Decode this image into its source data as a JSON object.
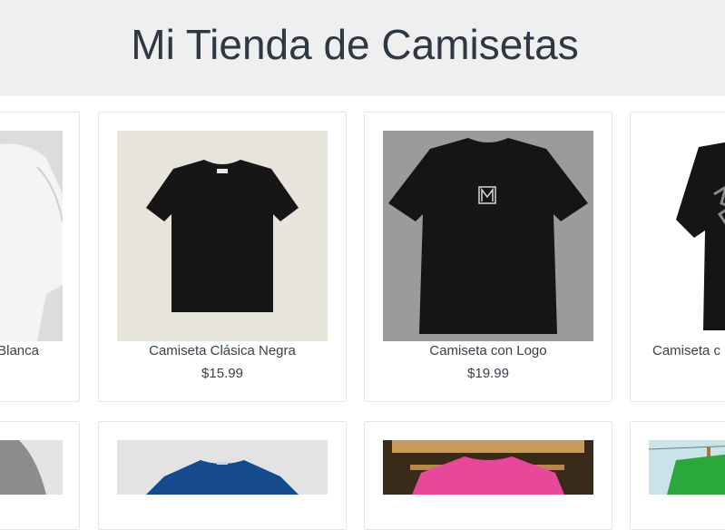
{
  "header": {
    "title": "Mi Tienda de Camisetas"
  },
  "products": [
    {
      "name": "Blanca",
      "price": "",
      "image": "white-tshirt-image"
    },
    {
      "name": "Camiseta Clásica Negra",
      "price": "$15.99",
      "image": "black-classic-tshirt-image"
    },
    {
      "name": "Camiseta con Logo",
      "price": "$19.99",
      "image": "black-logo-tshirt-image"
    },
    {
      "name": "Camiseta c",
      "price": "",
      "image": "black-print-tshirt-image"
    },
    {
      "name": "",
      "price": "",
      "image": "gray-tshirt-image"
    },
    {
      "name": "",
      "price": "",
      "image": "blue-tshirt-image"
    },
    {
      "name": "",
      "price": "",
      "image": "pink-tshirt-image"
    },
    {
      "name": "",
      "price": "",
      "image": "green-tshirt-image"
    }
  ],
  "colors": {
    "header_bg": "#efefef",
    "text": "#333b44",
    "card_border": "#e6e6e6"
  }
}
